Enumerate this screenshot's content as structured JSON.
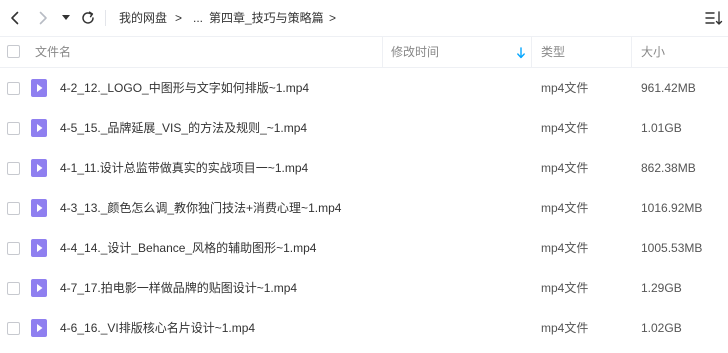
{
  "breadcrumb": {
    "root": "我的网盘",
    "sep": ">",
    "ellipsis": "...",
    "current": "第四章_技巧与策略篇"
  },
  "header": {
    "name": "文件名",
    "modified": "修改时间",
    "type": "类型",
    "size": "大小"
  },
  "files": [
    {
      "name": "4-2_12._LOGO_中图形与文字如何排版~1.mp4",
      "type": "mp4文件",
      "size": "961.42MB"
    },
    {
      "name": "4-5_15._品牌延展_VIS_的方法及规则_~1.mp4",
      "type": "mp4文件",
      "size": "1.01GB"
    },
    {
      "name": "4-1_11.设计总监带做真实的实战项目一~1.mp4",
      "type": "mp4文件",
      "size": "862.38MB"
    },
    {
      "name": "4-3_13._颜色怎么调_教你独门技法+消费心理~1.mp4",
      "type": "mp4文件",
      "size": "1016.92MB"
    },
    {
      "name": "4-4_14._设计_Behance_风格的辅助图形~1.mp4",
      "type": "mp4文件",
      "size": "1005.53MB"
    },
    {
      "name": "4-7_17.拍电影一样做品牌的贴图设计~1.mp4",
      "type": "mp4文件",
      "size": "1.29GB"
    },
    {
      "name": "4-6_16._VI排版核心名片设计~1.mp4",
      "type": "mp4文件",
      "size": "1.02GB"
    }
  ],
  "colors": {
    "accent": "#06a7ff",
    "video_icon": "#8f7ff0"
  }
}
